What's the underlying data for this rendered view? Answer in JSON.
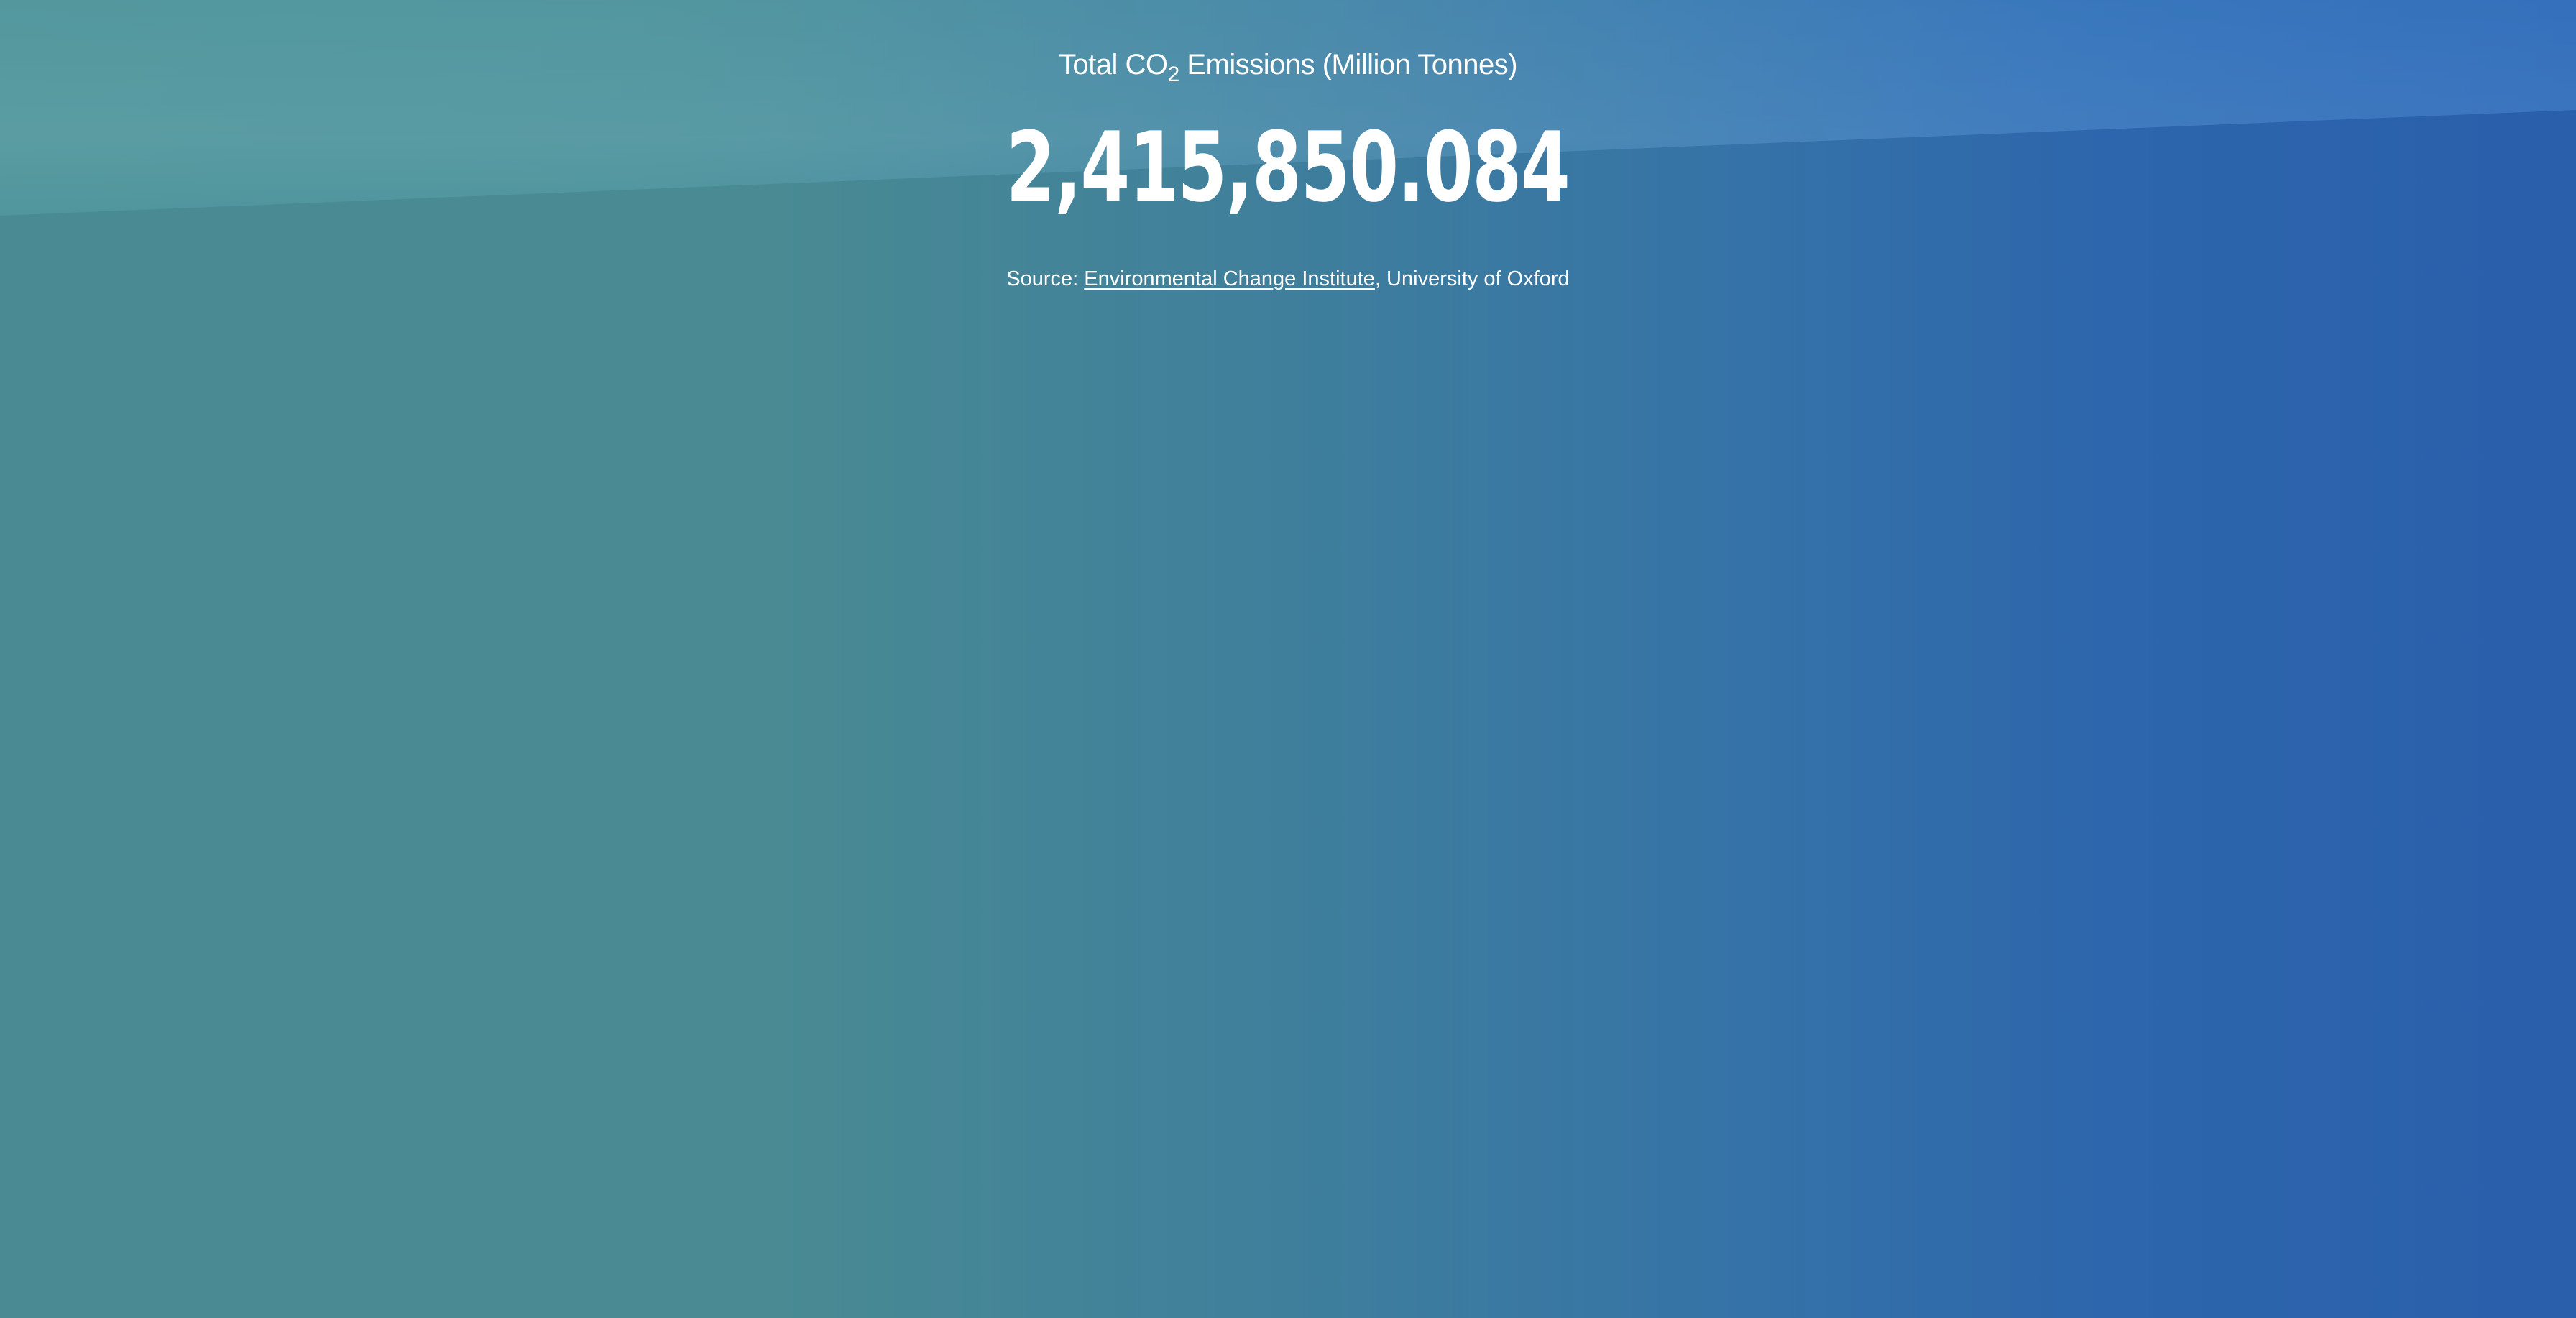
{
  "header": {
    "title_prefix": "Total CO",
    "title_subscript": "2",
    "title_suffix": " Emissions (Million Tonnes)"
  },
  "counter": {
    "value": "2,415,850.084"
  },
  "source": {
    "prefix": "Source: ",
    "link_text": "Environmental Change Institute",
    "suffix": ", University of Oxford"
  },
  "colors": {
    "text": "#ffffff",
    "background_left": "#498a93",
    "background_right": "#2a5fab"
  }
}
